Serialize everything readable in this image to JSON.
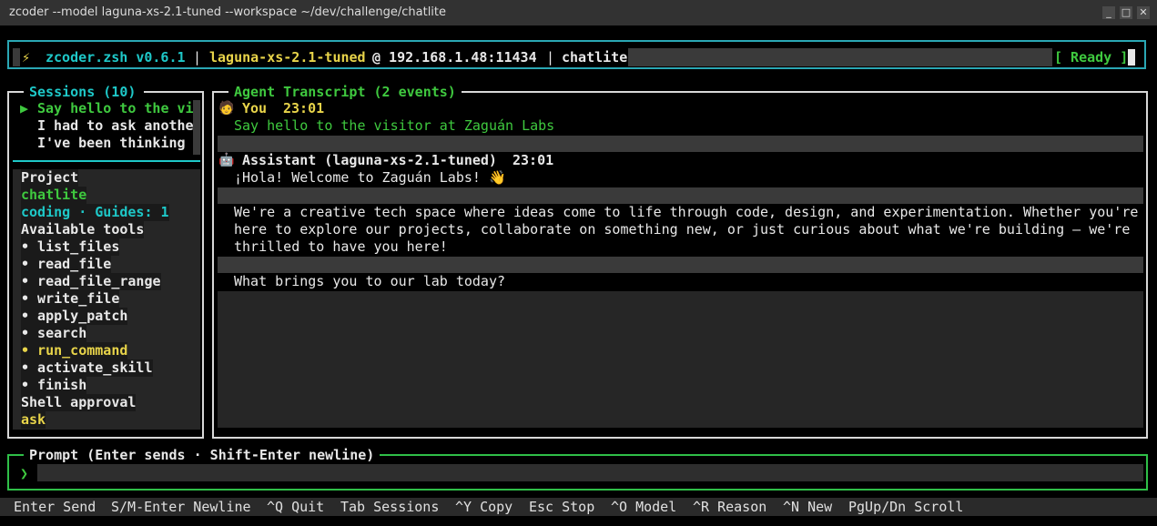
{
  "window": {
    "title": "zcoder --model laguna-xs-2.1-tuned --workspace ~/dev/challenge/chatlite",
    "btn_min": "_",
    "btn_max": "□",
    "btn_close": "✕"
  },
  "header": {
    "bolt": "⚡",
    "app": "zcoder.zsh v0.6.1",
    "sep1": "|",
    "model": "laguna-xs-2.1-tuned",
    "host": "@ 192.168.1.48:11434",
    "sep2": "|",
    "project": "chatlite",
    "status": "[ Ready ]"
  },
  "sessions": {
    "title": "Sessions (10)",
    "marker": "▶",
    "items": [
      "Say hello to the vi",
      "I had to ask anothe",
      "I've been thinking"
    ]
  },
  "project": {
    "label": "Project",
    "name": "chatlite",
    "mode": "coding · Guides: 1",
    "tools_label": "Available tools",
    "tools": [
      "• list_files",
      "• read_file",
      "• read_file_range",
      "• write_file",
      "• apply_patch",
      "• search",
      "• run_command",
      "• activate_skill",
      "• finish"
    ],
    "approval_label": "Shell approval",
    "approval_value": "ask"
  },
  "transcript": {
    "title": "Agent Transcript (2 events)",
    "user_icon": "🧑",
    "user_label": "You",
    "user_time": "23:01",
    "user_msg": "Say hello to the visitor at Zaguán Labs",
    "bot_icon": "🤖",
    "bot_label": "Assistant (laguna-xs-2.1-tuned)",
    "bot_time": "23:01",
    "bot_lines": [
      "¡Hola! Welcome to Zaguán Labs! 👋",
      "We're a creative tech space where ideas come to life through code, design, and experimentation. Whether you're",
      "here to explore our projects, collaborate on something new, or just curious about what we're building – we're",
      "thrilled to have you here!",
      "What brings you to our lab today?"
    ]
  },
  "prompt": {
    "title": "Prompt (Enter sends · Shift-Enter newline)",
    "caret": "❯",
    "value": ""
  },
  "footer": [
    "Enter Send",
    "S/M-Enter Newline",
    "^Q Quit",
    "Tab Sessions",
    "^Y Copy",
    "Esc Stop",
    "^O Model",
    "^R Reason",
    "^N New",
    "PgUp/Dn Scroll"
  ],
  "colors": {
    "cyan": "#1ec8c8",
    "yellow": "#e8d44a",
    "green": "#3fc93f",
    "border_header": "#2aa7b4",
    "border_prompt": "#2fbf48"
  }
}
